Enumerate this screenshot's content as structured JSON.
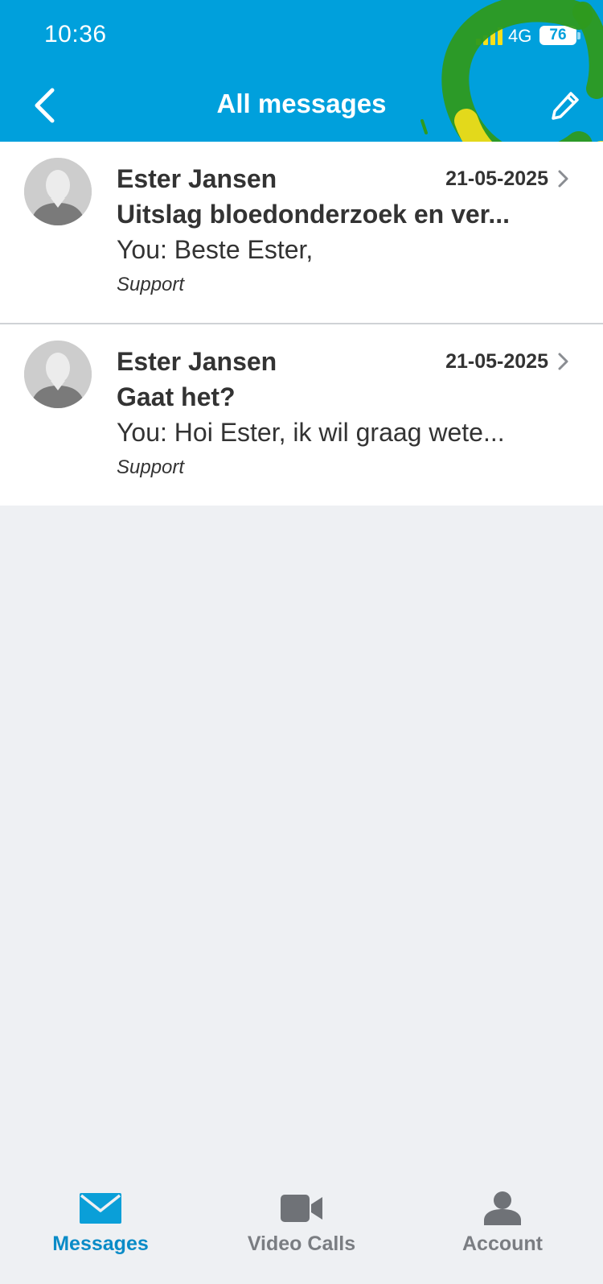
{
  "status_bar": {
    "time": "10:36",
    "network": "4G",
    "battery": "76"
  },
  "header": {
    "title": "All messages",
    "back_icon": "chevron-left-icon",
    "compose_icon": "pencil-icon"
  },
  "messages": [
    {
      "sender": "Ester Jansen",
      "date": "21-05-2025",
      "subject": "Uitslag bloedonderzoek en ver...",
      "preview": "You: Beste Ester,",
      "category": "Support"
    },
    {
      "sender": "Ester Jansen",
      "date": "21-05-2025",
      "subject": "Gaat het?",
      "preview": "You: Hoi Ester, ik wil graag wete...",
      "category": "Support"
    }
  ],
  "tabs": [
    {
      "label": "Messages",
      "icon": "envelope-icon",
      "active": true
    },
    {
      "label": "Video Calls",
      "icon": "video-camera-icon",
      "active": false
    },
    {
      "label": "Account",
      "icon": "person-icon",
      "active": false
    }
  ],
  "colors": {
    "header_bg": "#00a0dc",
    "page_bg": "#eef0f3",
    "active_tab": "#0a8bc7",
    "inactive_tab": "#7a7d82",
    "annotation_green": "#2e9a1e",
    "annotation_yellow": "#f7e01a"
  }
}
